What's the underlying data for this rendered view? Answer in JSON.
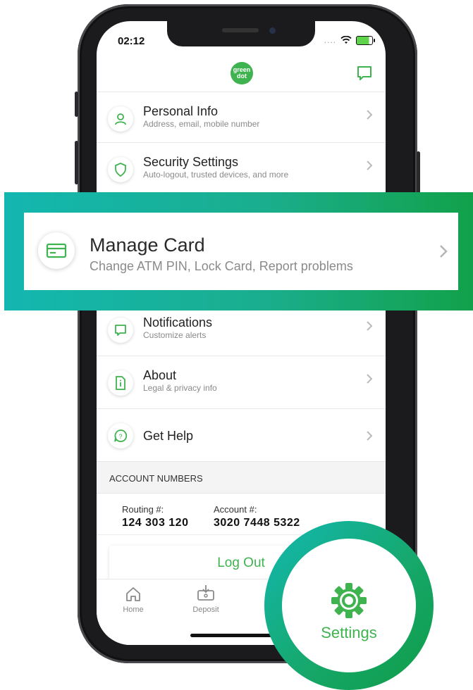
{
  "status_bar": {
    "time": "02:12",
    "signal": "...."
  },
  "header": {
    "logo_line1": "green",
    "logo_line2": "dot"
  },
  "menu": [
    {
      "title": "Personal Info",
      "subtitle": "Address, email, mobile number",
      "icon": "person-icon"
    },
    {
      "title": "Security Settings",
      "subtitle": "Auto-logout, trusted devices, and more",
      "icon": "shield-icon"
    },
    {
      "title": "Notifications",
      "subtitle": "Customize alerts",
      "icon": "message-icon"
    },
    {
      "title": "About",
      "subtitle": "Legal & privacy info",
      "icon": "info-document-icon"
    },
    {
      "title": "Get Help",
      "subtitle": "",
      "icon": "help-chat-icon"
    }
  ],
  "highlight": {
    "title": "Manage Card",
    "subtitle": "Change ATM PIN, Lock Card, Report problems",
    "icon": "card-icon"
  },
  "account": {
    "header": "ACCOUNT NUMBERS",
    "routing_label": "Routing #:",
    "routing_value": "124 303 120",
    "account_label": "Account #:",
    "account_value": "3020 7448 5322"
  },
  "logout_label": "Log Out",
  "tabs": {
    "home": "Home",
    "deposit": "Deposit",
    "settings": "Settings"
  },
  "colors": {
    "brand_green": "#3fb34f",
    "teal": "#13b7b0",
    "dark_green": "#12a14a"
  }
}
